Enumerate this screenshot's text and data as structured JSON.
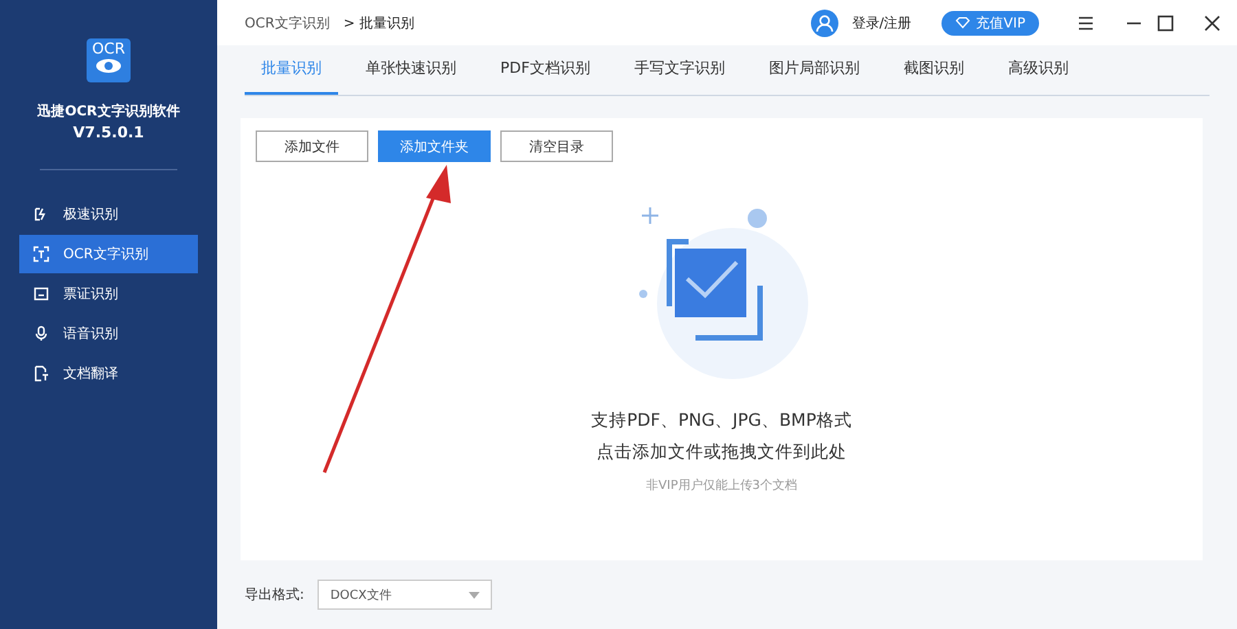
{
  "app": {
    "logo_text": "OCR",
    "name": "迅捷OCR文字识别软件",
    "version": "V7.5.0.1"
  },
  "sidebar": {
    "items": [
      {
        "label": "极速识别",
        "kind": "bolt",
        "selected": false
      },
      {
        "label": "OCR文字识别",
        "kind": "scan",
        "selected": true
      },
      {
        "label": "票证识别",
        "kind": "ticket",
        "selected": false
      },
      {
        "label": "语音识别",
        "kind": "mic",
        "selected": false
      },
      {
        "label": "文档翻译",
        "kind": "translate",
        "selected": false
      }
    ]
  },
  "breadcrumb": {
    "parent": "OCR文字识别",
    "separator": ">",
    "current": "批量识别"
  },
  "header": {
    "login": "登录/注册",
    "vip": "充值VIP"
  },
  "tabs": [
    {
      "label": "批量识别",
      "selected": true
    },
    {
      "label": "单张快速识别",
      "selected": false
    },
    {
      "label": "PDF文档识别",
      "selected": false
    },
    {
      "label": "手写文字识别",
      "selected": false
    },
    {
      "label": "图片局部识别",
      "selected": false
    },
    {
      "label": "截图识别",
      "selected": false
    },
    {
      "label": "高级识别",
      "selected": false
    }
  ],
  "buttons": [
    {
      "label": "添加文件",
      "selected": false
    },
    {
      "label": "添加文件夹",
      "selected": true
    },
    {
      "label": "清空目录",
      "selected": false
    }
  ],
  "dropzone": {
    "line1": "支持PDF、PNG、JPG、BMP格式",
    "line2": "点击添加文件或拖拽文件到此处",
    "note": "非VIP用户仅能上传3个文档"
  },
  "export": {
    "label": "导出格式:",
    "value": "DOCX文件"
  }
}
